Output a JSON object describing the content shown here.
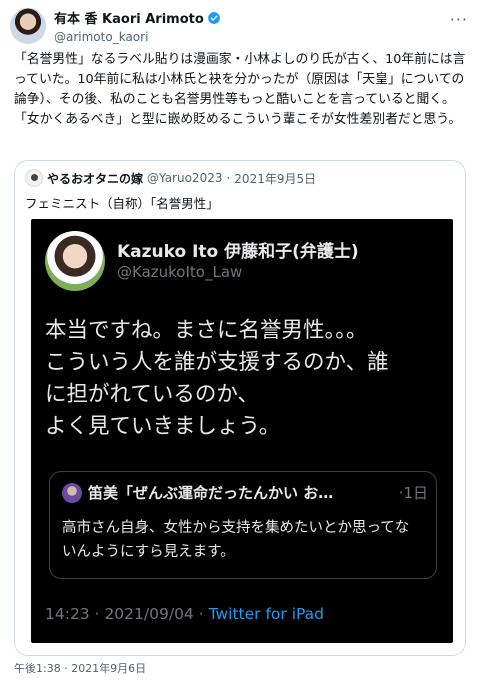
{
  "author": {
    "name": "有本 香 Kaori Arimoto",
    "handle": "@arimoto_kaori",
    "verified_color": "#1d9bf0"
  },
  "more_icon": "more-icon",
  "tweet": {
    "text": "「名誉男性」なるラベル貼りは漫画家・小林よしのり氏が古く、10年前には言っていた。10年前に私は小林氏と袂を分かったが（原因は「天皇」についての論争）、その後、私のことも名誉男性等もっと酷いことを言っていると聞く。「女かくあるべき」と型に嵌め貶めるこういう輩こそが女性差別者だと思う。",
    "timestamp": "午後1:38 · 2021年9月6日"
  },
  "quote": {
    "name": "やるおオタニの嫁",
    "handle": "@Yaruo2023",
    "separator": "·",
    "date": "2021年9月5日",
    "text": "フェミニスト（自称）「名誉男性」",
    "image": {
      "name": "Kazuko Ito 伊藤和子(弁護士)",
      "handle": "@KazukoIto_Law",
      "body_lines": [
        "本当ですね。まさに名誉男性。。。",
        "こういう人を誰が支援するのか、誰",
        "に担がれているのか、",
        "よく見ていきましょう。"
      ],
      "inner_quote": {
        "name": "笛美「ぜんぶ運命だったんかい お…",
        "time": "·1日",
        "body": "高市さん自身、女性から支持を集めたいとか思ってないんようにすら見えます。"
      },
      "footer_time": "14:23 · 2021/09/04 · ",
      "footer_source": "Twitter for iPad"
    }
  }
}
